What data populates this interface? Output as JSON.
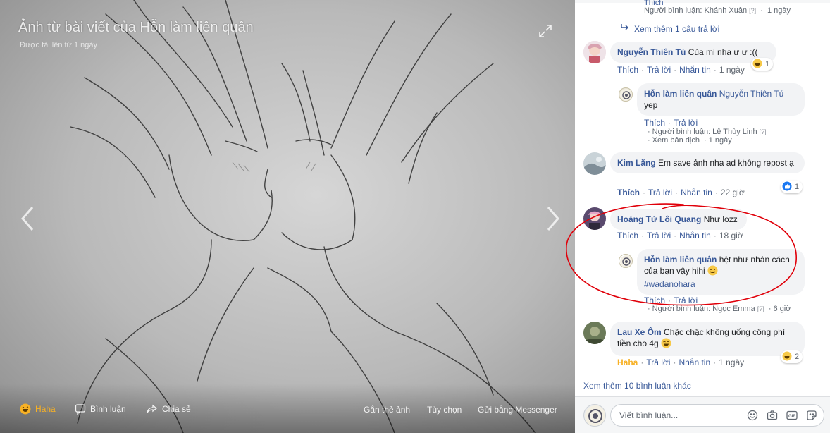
{
  "viewer": {
    "caption": "Ảnh từ bài viết của Hỗn làm liên quân",
    "subcaption": "Được tải lên từ 1 ngày",
    "actions": {
      "haha": "Haha",
      "comment": "Bình luận",
      "share": "Chia sẻ",
      "tag": "Gắn thẻ ảnh",
      "options": "Tùy chọn",
      "messenger": "Gửi bằng Messenger"
    }
  },
  "panel": {
    "top_meta": {
      "like": "Thích",
      "commenter_label": "Người bình luận: Khánh Xuân",
      "q": "[?]",
      "time": "1 ngày"
    },
    "more_replies": "Xem thêm 1 câu trả lời",
    "comments": [
      {
        "author": "Nguyễn Thiên Tú",
        "text": "Của mi nha ư ư :((",
        "like": "Thích",
        "reply": "Trả lời",
        "msg": "Nhắn tin",
        "time": "1 ngày",
        "reaction": "haha",
        "reaction_count": "1",
        "replies": [
          {
            "author": "Hỗn làm liên quân",
            "mention": "Nguyễn Thiên Tú",
            "text": "yep",
            "like": "Thích",
            "reply": "Trả lời",
            "commenter_label": "Người bình luận: Lê Thùy Linh",
            "q": "[?]",
            "translate": "Xem bản dịch",
            "time": "1 ngày"
          }
        ]
      },
      {
        "author": "Kim Lăng",
        "text": "Em save ảnh nha ad không repost ạ",
        "like": "Thích",
        "reply": "Trả lời",
        "msg": "Nhắn tin",
        "time": "22 giờ",
        "reaction": "like",
        "reaction_count": "1"
      },
      {
        "author": "Hoàng Tử Lôi Quang",
        "text": "Như lozz",
        "like": "Thích",
        "reply": "Trả lời",
        "msg": "Nhắn tin",
        "time": "18 giờ",
        "replies": [
          {
            "author": "Hỗn làm liên quân",
            "text": "hệt như nhân cách của bạn vậy hihi",
            "hashtag": "#wadanohara",
            "like": "Thích",
            "reply": "Trả lời",
            "commenter_label": "Người bình luận: Ngọc Emma",
            "q": "[?]",
            "time": "6 giờ"
          }
        ]
      },
      {
        "author": "Lau Xe Ôm",
        "text": "Chậc chậc không uống công phí tiền cho 4g",
        "like": "Haha",
        "reply": "Trả lời",
        "msg": "Nhắn tin",
        "time": "1 ngày",
        "reaction": "haha",
        "reaction_count": "2"
      }
    ],
    "see_more": "Xem thêm 10 bình luận khác",
    "composer_placeholder": "Viết bình luận..."
  },
  "colors": {
    "link": "#385898",
    "haha": "#f7b125",
    "bubble": "#f2f3f5",
    "annotation": "#e0000a"
  }
}
